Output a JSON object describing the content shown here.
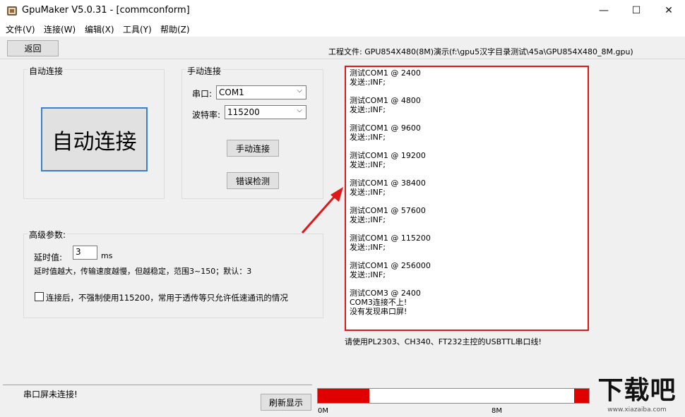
{
  "window": {
    "title": "GpuMaker V5.0.31 - [commconform]",
    "minimize_glyph": "—",
    "maximize_glyph": "☐",
    "close_glyph": "✕"
  },
  "menu": {
    "items": [
      "文件(V)",
      "连接(W)",
      "编辑(X)",
      "工具(Y)",
      "帮助(Z)"
    ]
  },
  "toolbar": {
    "back_label": "返回",
    "project_file": "工程文件:  GPU854X480(8M)演示(f:\\gpu5汉字目录测试\\45a\\GPU854X480_8M.gpu)"
  },
  "auto_connect": {
    "group_title": "自动连接",
    "button_label": "自动连接"
  },
  "manual_connect": {
    "group_title": "手动连接",
    "port_label": "串口:",
    "port_value": "COM1",
    "baud_label": "波特率:",
    "baud_value": "115200",
    "connect_label": "手动连接",
    "error_check_label": "错误检测"
  },
  "advanced": {
    "group_title": "高级参数:",
    "delay_label": "延时值:",
    "delay_value": "3",
    "delay_unit": "ms",
    "delay_hint": "延时值越大，传输速度越慢，但越稳定，范围3~150；默认：3",
    "checkbox_label": "连接后，不强制使用115200，常用于透传等只允许低速通讯的情况",
    "checkbox_checked": false
  },
  "log": {
    "blocks": [
      [
        "测试COM1 @ 2400",
        "发送:;INF;"
      ],
      [
        "测试COM1 @ 4800",
        "发送:;INF;"
      ],
      [
        "测试COM1 @ 9600",
        "发送:;INF;"
      ],
      [
        "测试COM1 @ 19200",
        "发送:;INF;"
      ],
      [
        "测试COM1 @ 38400",
        "发送:;INF;"
      ],
      [
        "测试COM1 @ 57600",
        "发送:;INF;"
      ],
      [
        "测试COM1 @ 115200",
        "发送:;INF;"
      ],
      [
        "测试COM1 @ 256000",
        "发送:;INF;"
      ],
      [
        "测试COM3 @ 2400",
        "COM3连接不上!",
        "没有发现串口屏!"
      ]
    ],
    "hint": "请使用PL2303、CH340、FT232主控的USBTTL串口线!"
  },
  "status": {
    "text": "串口屏未连接!",
    "refresh_label": "刷新显示",
    "progress_min": "0M",
    "progress_mid": "8M",
    "used_start_fraction": 0.19,
    "used_end_fraction": 0.055
  },
  "watermark": {
    "logo_text": "下载吧",
    "url": "www.xiazaiba.com"
  },
  "colors": {
    "highlight": "#e01717",
    "accent_border": "#3c7fc4"
  }
}
